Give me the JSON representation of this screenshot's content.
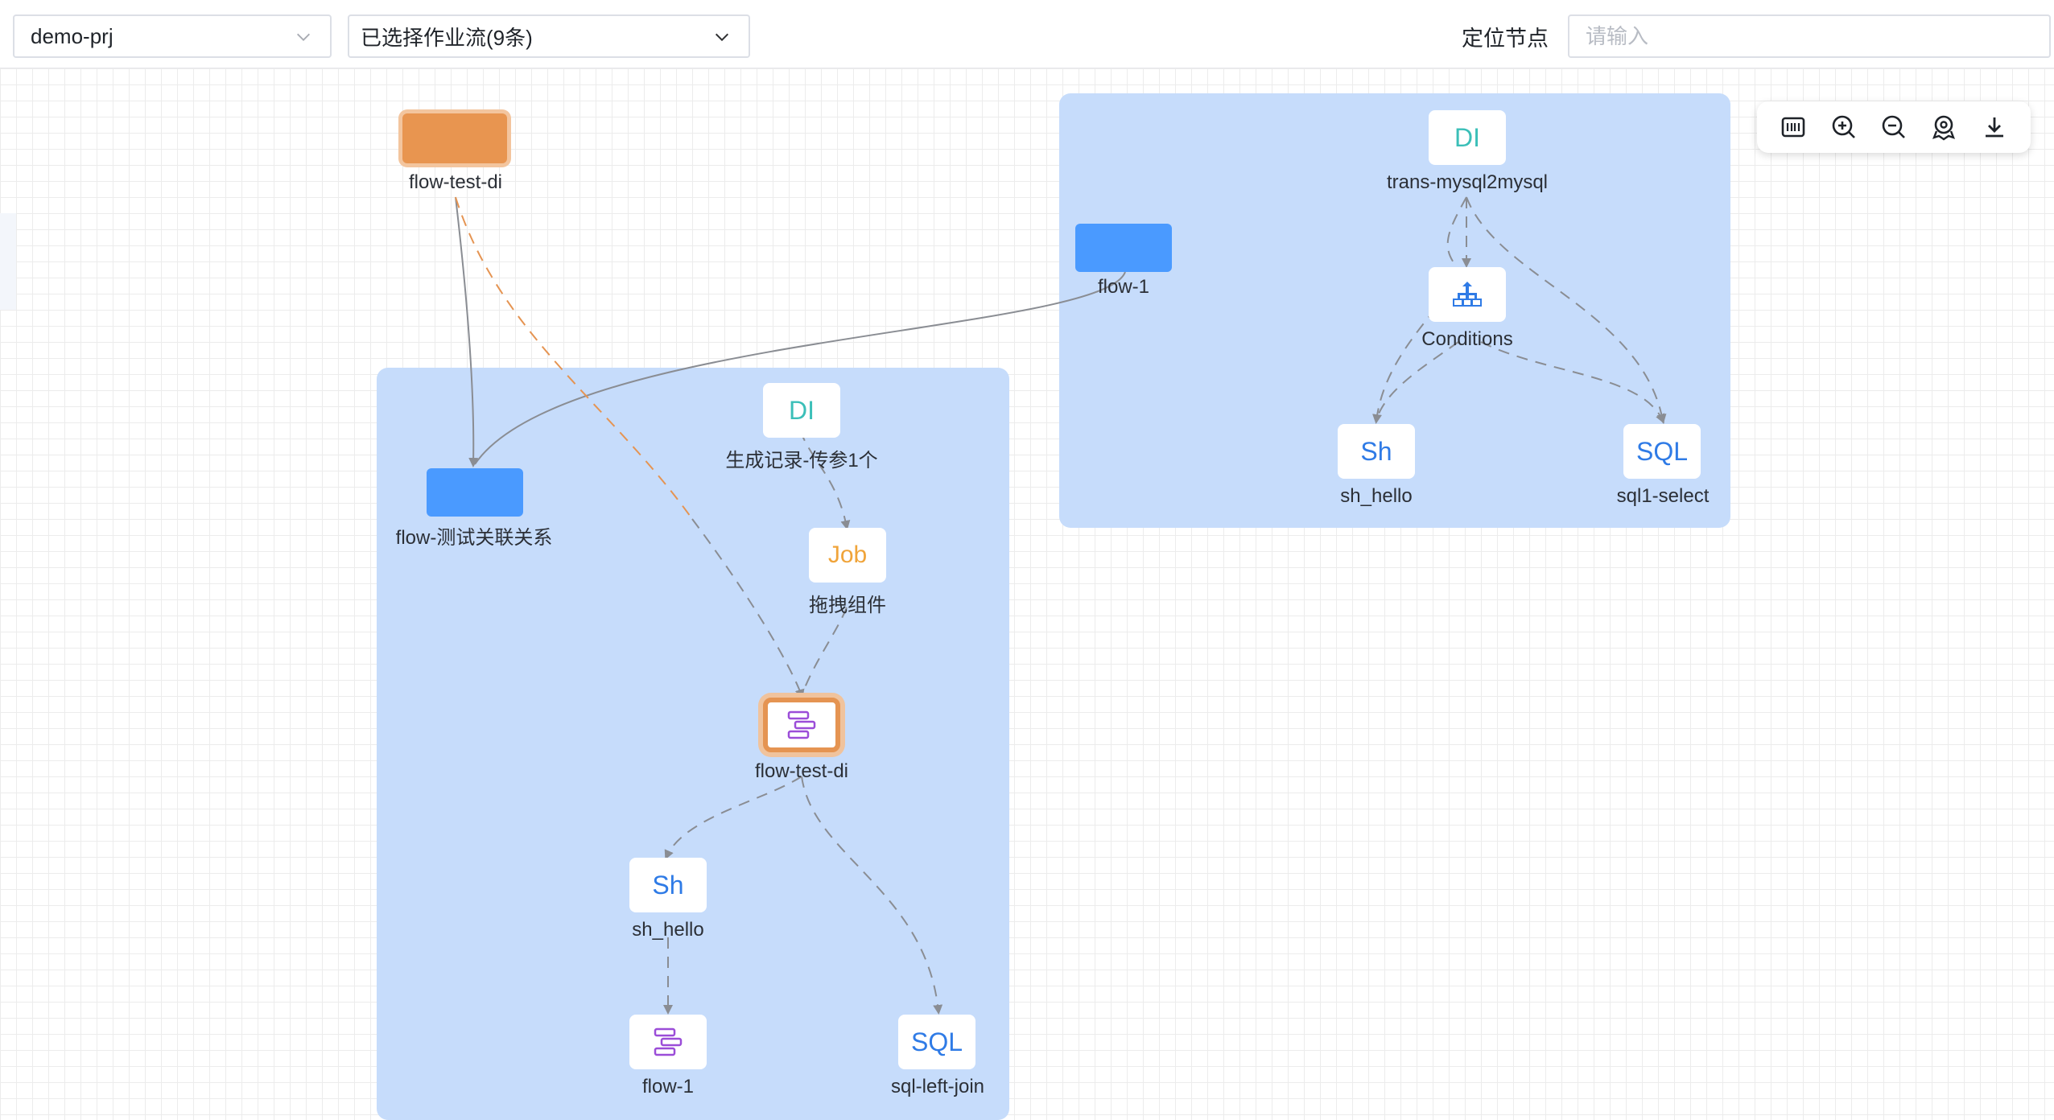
{
  "header": {
    "project_select": "demo-prj",
    "workflow_select": "已选择作业流(9条)",
    "locate_label": "定位节点",
    "locate_placeholder": "请输入"
  },
  "toolbar": {
    "icons": [
      "fit-view-icon",
      "zoom-in-icon",
      "zoom-out-icon",
      "locate-icon",
      "download-icon"
    ]
  },
  "colors": {
    "group_fill": "#c6dcfb",
    "flow_bar": "#4a9aff",
    "highlight": "#e59452",
    "di": "#3bbfb8",
    "job": "#f0a43a",
    "sh_sql": "#2f7be6",
    "flow_icon": "#9b4dd8"
  },
  "nodes": {
    "flow_test_di_top": {
      "label": "flow-test-di"
    },
    "flow_1_bar": {
      "label": "flow-1"
    },
    "flow_relation_bar": {
      "label": "flow-测试关联关系"
    },
    "left_group": {
      "di": {
        "icon": "DI",
        "label": "生成记录-传参1个"
      },
      "job": {
        "icon": "Job",
        "label": "拖拽组件"
      },
      "flow_test_di": {
        "label": "flow-test-di"
      },
      "sh_hello": {
        "icon": "Sh",
        "label": "sh_hello"
      },
      "flow_1": {
        "label": "flow-1"
      },
      "sql_left_join": {
        "icon": "SQL",
        "label": "sql-left-join"
      }
    },
    "right_group": {
      "di": {
        "icon": "DI",
        "label": "trans-mysql2mysql"
      },
      "conditions": {
        "label": "Conditions"
      },
      "sh_hello": {
        "icon": "Sh",
        "label": "sh_hello"
      },
      "sql1_select": {
        "icon": "SQL",
        "label": "sql1-select"
      }
    }
  }
}
